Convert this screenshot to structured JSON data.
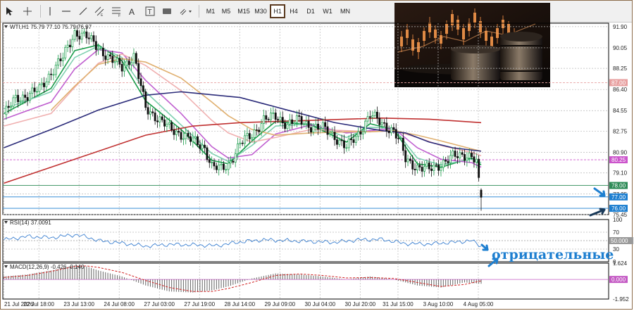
{
  "toolbar": {
    "tools": [
      "cursor-icon",
      "crosshair-icon",
      "vertical-line-icon",
      "horizontal-line-icon",
      "trendline-icon",
      "equidistant-channel-icon",
      "fibonacci-icon",
      "text-icon",
      "text-label-icon",
      "rectangle-icon",
      "shapes-icon"
    ],
    "timeframes": [
      "M1",
      "M5",
      "M15",
      "M30",
      "H1",
      "H4",
      "D1",
      "W1",
      "MN"
    ],
    "active_timeframe": "H1"
  },
  "chart_data": [
    {
      "type": "candlestick",
      "title": "WTI,H1  75.79 77.10 75.79 76.97",
      "ylim": [
        75.45,
        92.2
      ],
      "y_ticks": [
        "91.90",
        "90.05",
        "88.25",
        "86.40",
        "84.55",
        "82.75",
        "80.90",
        "79.10",
        "77.25",
        "75.45"
      ],
      "x_ticks": [
        "21 Jul 2026",
        "22 Jul 18:00",
        "23 Jul 13:00",
        "24 Jul 08:00",
        "27 Jul 03:00",
        "27 Jul 19:00",
        "28 Jul 14:00",
        "29 Jul 09:00",
        "30 Jul 04:00",
        "30 Jul 20:00",
        "31 Jul 15:00",
        "3 Aug 10:00",
        "4 Aug 05:00"
      ],
      "close_path": [
        [
          0,
          84.2
        ],
        [
          5,
          85.6
        ],
        [
          10,
          85.9
        ],
        [
          15,
          86.4
        ],
        [
          20,
          87.9
        ],
        [
          25,
          89.2
        ],
        [
          30,
          91.4
        ],
        [
          35,
          91.0
        ],
        [
          40,
          90.1
        ],
        [
          45,
          89.0
        ],
        [
          50,
          88.4
        ],
        [
          55,
          89.3
        ],
        [
          60,
          84.8
        ],
        [
          65,
          83.9
        ],
        [
          70,
          83.0
        ],
        [
          75,
          82.5
        ],
        [
          80,
          81.9
        ],
        [
          85,
          81.3
        ],
        [
          88,
          79.7
        ],
        [
          92,
          79.4
        ],
        [
          95,
          79.8
        ],
        [
          100,
          81.7
        ],
        [
          105,
          82.4
        ],
        [
          110,
          83.8
        ],
        [
          115,
          84.0
        ],
        [
          120,
          83.4
        ],
        [
          125,
          83.7
        ],
        [
          130,
          83.2
        ],
        [
          135,
          83.0
        ],
        [
          140,
          82.3
        ],
        [
          145,
          81.3
        ],
        [
          150,
          82.5
        ],
        [
          155,
          84.2
        ],
        [
          160,
          83.4
        ],
        [
          165,
          82.8
        ],
        [
          168,
          81.6
        ],
        [
          170,
          80.3
        ],
        [
          175,
          79.6
        ],
        [
          180,
          79.4
        ],
        [
          185,
          79.9
        ],
        [
          190,
          80.5
        ],
        [
          195,
          80.7
        ],
        [
          198,
          80.6
        ],
        [
          200,
          80.0
        ],
        [
          202,
          76.4
        ]
      ],
      "last_candle": {
        "open": 77.6,
        "high": 77.75,
        "low": 75.79,
        "close": 76.97
      },
      "horizontal_levels": [
        {
          "value": 87.0,
          "label": "87.00",
          "color": "#e8a0a0",
          "style": "dashed"
        },
        {
          "value": 80.25,
          "label": "80.25",
          "color": "#cc55cc",
          "style": "dashed"
        },
        {
          "value": 78.0,
          "label": "78.00",
          "color": "#2e8b57",
          "style": "solid"
        },
        {
          "value": 77.0,
          "label": "77.00",
          "color": "#1e7fd0",
          "style": "solid"
        },
        {
          "value": 76.0,
          "label": "76.00",
          "color": "#1e7fd0",
          "style": "solid"
        }
      ],
      "moving_averages": [
        {
          "color": "#1a9c4a",
          "path": [
            [
              0,
              84.3
            ],
            [
              20,
              86.5
            ],
            [
              30,
              89.8
            ],
            [
              40,
              90.3
            ],
            [
              50,
              88.9
            ],
            [
              60,
              85.4
            ],
            [
              75,
              82.9
            ],
            [
              88,
              80.2
            ],
            [
              95,
              79.9
            ],
            [
              105,
              81.9
            ],
            [
              115,
              83.6
            ],
            [
              130,
              83.3
            ],
            [
              145,
              81.8
            ],
            [
              155,
              83.4
            ],
            [
              165,
              82.9
            ],
            [
              175,
              79.9
            ],
            [
              185,
              79.6
            ],
            [
              198,
              80.4
            ],
            [
              202,
              79.8
            ]
          ]
        },
        {
          "color": "#7fd0b0",
          "path": [
            [
              0,
              84.7
            ],
            [
              20,
              86.2
            ],
            [
              30,
              89.2
            ],
            [
              40,
              90.2
            ],
            [
              50,
              89.2
            ],
            [
              60,
              86.2
            ],
            [
              75,
              83.3
            ],
            [
              88,
              80.8
            ],
            [
              95,
              80.1
            ],
            [
              105,
              81.5
            ],
            [
              115,
              83.2
            ],
            [
              130,
              83.4
            ],
            [
              145,
              82.2
            ],
            [
              155,
              83.1
            ],
            [
              165,
              83.0
            ],
            [
              175,
              80.4
            ],
            [
              185,
              79.8
            ],
            [
              198,
              80.3
            ],
            [
              202,
              80.0
            ]
          ]
        },
        {
          "color": "#c060d0",
          "path": [
            [
              0,
              83.8
            ],
            [
              20,
              85.3
            ],
            [
              30,
              88.2
            ],
            [
              40,
              89.9
            ],
            [
              50,
              89.6
            ],
            [
              60,
              87.2
            ],
            [
              75,
              84.3
            ],
            [
              88,
              81.4
            ],
            [
              95,
              80.4
            ],
            [
              105,
              80.7
            ],
            [
              115,
              82.5
            ],
            [
              130,
              83.3
            ],
            [
              145,
              82.6
            ],
            [
              155,
              82.8
            ],
            [
              165,
              83.0
            ],
            [
              175,
              81.3
            ],
            [
              185,
              80.3
            ],
            [
              198,
              80.0
            ],
            [
              202,
              79.6
            ]
          ]
        },
        {
          "color": "#f0b0b0",
          "path": [
            [
              0,
              83.2
            ],
            [
              20,
              84.3
            ],
            [
              30,
              86.6
            ],
            [
              40,
              88.7
            ],
            [
              50,
              89.5
            ],
            [
              60,
              88.5
            ],
            [
              75,
              86.3
            ],
            [
              88,
              83.7
            ],
            [
              95,
              82.6
            ],
            [
              105,
              81.8
            ],
            [
              115,
              82.2
            ],
            [
              130,
              82.9
            ],
            [
              145,
              82.8
            ],
            [
              155,
              82.7
            ],
            [
              165,
              82.8
            ],
            [
              175,
              82.2
            ],
            [
              185,
              81.5
            ],
            [
              198,
              80.9
            ],
            [
              202,
              80.6
            ]
          ]
        },
        {
          "color": "#e0b070",
          "path": [
            [
              20,
              84.6
            ],
            [
              30,
              86.7
            ],
            [
              40,
              88.6
            ],
            [
              50,
              89.1
            ],
            [
              60,
              88.8
            ],
            [
              75,
              87.4
            ],
            [
              88,
              85.3
            ],
            [
              95,
              84.1
            ],
            [
              105,
              82.9
            ],
            [
              115,
              82.4
            ],
            [
              130,
              82.6
            ],
            [
              145,
              82.7
            ],
            [
              155,
              82.7
            ],
            [
              165,
              82.8
            ],
            [
              175,
              82.4
            ],
            [
              185,
              81.9
            ],
            [
              198,
              81.2
            ],
            [
              202,
              81.0
            ]
          ]
        },
        {
          "color": "#2c2c7a",
          "path": [
            [
              0,
              81.3
            ],
            [
              20,
              82.9
            ],
            [
              40,
              84.6
            ],
            [
              60,
              85.9
            ],
            [
              75,
              86.2
            ],
            [
              100,
              85.7
            ],
            [
              120,
              84.6
            ],
            [
              140,
              83.5
            ],
            [
              160,
              82.8
            ],
            [
              170,
              82.6
            ],
            [
              180,
              81.8
            ],
            [
              190,
              81.3
            ],
            [
              202,
              81.0
            ]
          ]
        },
        {
          "color": "#c03030",
          "path": [
            [
              0,
              78.2
            ],
            [
              30,
              80.3
            ],
            [
              60,
              82.4
            ],
            [
              80,
              83.2
            ],
            [
              100,
              83.5
            ],
            [
              130,
              83.7
            ],
            [
              160,
              83.9
            ],
            [
              180,
              83.8
            ],
            [
              202,
              83.5
            ]
          ]
        }
      ]
    },
    {
      "type": "line",
      "title": "RSI(14) 37.0091",
      "ylim": [
        0,
        100
      ],
      "y_ticks": [
        "100",
        "70",
        "50.000",
        "30",
        "0"
      ],
      "levels": [
        70,
        50,
        30
      ],
      "series": [
        {
          "color": "#3a7fd0",
          "values": [
            [
              0,
              52
            ],
            [
              10,
              60
            ],
            [
              20,
              57
            ],
            [
              30,
              64
            ],
            [
              35,
              59
            ],
            [
              40,
              50
            ],
            [
              50,
              44
            ],
            [
              60,
              37
            ],
            [
              70,
              41
            ],
            [
              80,
              40
            ],
            [
              90,
              38
            ],
            [
              100,
              47
            ],
            [
              110,
              52
            ],
            [
              120,
              50
            ],
            [
              130,
              48
            ],
            [
              140,
              46
            ],
            [
              150,
              52
            ],
            [
              160,
              53
            ],
            [
              170,
              43
            ],
            [
              180,
              42
            ],
            [
              190,
              46
            ],
            [
              198,
              50
            ],
            [
              202,
              37
            ]
          ]
        }
      ]
    },
    {
      "type": "bar",
      "title": "MACD(12,26,9) -0.426 -0.140",
      "ylim": [
        -1.952,
        1.624
      ],
      "y_ticks": [
        "1.624",
        "0.000",
        "-1.952"
      ],
      "histogram_path": [
        [
          0,
          0.3
        ],
        [
          10,
          0.5
        ],
        [
          20,
          0.9
        ],
        [
          30,
          1.4
        ],
        [
          35,
          1.3
        ],
        [
          40,
          0.9
        ],
        [
          50,
          0.3
        ],
        [
          60,
          -0.6
        ],
        [
          70,
          -1.2
        ],
        [
          80,
          -1.3
        ],
        [
          88,
          -1.1
        ],
        [
          95,
          -0.7
        ],
        [
          105,
          0.1
        ],
        [
          115,
          0.6
        ],
        [
          125,
          0.5
        ],
        [
          135,
          0.3
        ],
        [
          145,
          0.0
        ],
        [
          155,
          0.3
        ],
        [
          165,
          0.0
        ],
        [
          175,
          -0.6
        ],
        [
          185,
          -0.8
        ],
        [
          195,
          -0.3
        ],
        [
          202,
          -0.43
        ]
      ],
      "signal_path": [
        [
          0,
          0.2
        ],
        [
          10,
          0.4
        ],
        [
          20,
          0.8
        ],
        [
          30,
          1.3
        ],
        [
          35,
          1.35
        ],
        [
          40,
          1.2
        ],
        [
          50,
          0.7
        ],
        [
          60,
          -0.1
        ],
        [
          70,
          -0.8
        ],
        [
          80,
          -1.2
        ],
        [
          88,
          -1.2
        ],
        [
          95,
          -0.9
        ],
        [
          105,
          -0.3
        ],
        [
          115,
          0.4
        ],
        [
          125,
          0.55
        ],
        [
          135,
          0.4
        ],
        [
          145,
          0.15
        ],
        [
          155,
          0.2
        ],
        [
          165,
          0.1
        ],
        [
          175,
          -0.3
        ],
        [
          185,
          -0.7
        ],
        [
          195,
          -0.5
        ],
        [
          202,
          -0.14
        ]
      ]
    }
  ],
  "annotation": {
    "text": "отрицательные"
  },
  "colors": {
    "bull": "#1a9c4a",
    "bear": "#111111",
    "grid": "#b8b8b8",
    "arrow": "#1e7fd0",
    "annotation": "#1e7fd0"
  }
}
